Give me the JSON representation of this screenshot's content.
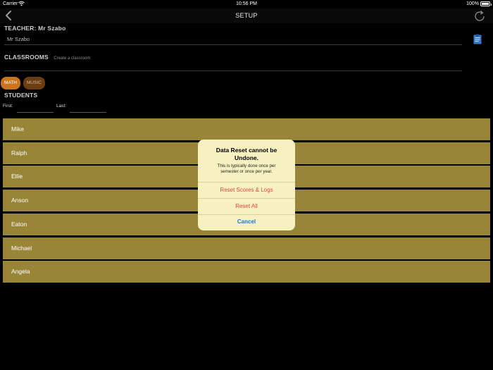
{
  "status_bar": {
    "carrier": "Carrier",
    "time": "10:56 PM",
    "battery": "100%"
  },
  "nav": {
    "title": "SETUP"
  },
  "teacher": {
    "label": "TEACHER: Mr Szabo",
    "name_value": "Mr Szabo"
  },
  "classrooms": {
    "label": "CLASSROOMS",
    "placeholder": "Create a classroom:",
    "chips": [
      "MATH",
      "MUSIC"
    ]
  },
  "students": {
    "label": "STUDENTS",
    "first_label": "First:",
    "last_label": "Last:",
    "list": [
      "Mike",
      "Ralph",
      "Ellie",
      "Anson",
      "Eaton",
      "Michael",
      "Angela"
    ]
  },
  "alert": {
    "title": "Data Reset cannot be Undone.",
    "message": "This is typically done once per semester or once per year.",
    "reset_scores_label": "Reset Scores & Logs",
    "reset_all_label": "Reset All",
    "cancel_label": "Cancel"
  },
  "colors": {
    "row_background": "#998538",
    "alert_background": "#f7f0c0",
    "destructive": "#e0473f",
    "cancel": "#1a76e8",
    "chip_math": "#c9741e",
    "chip_music": "#6a3e12"
  }
}
